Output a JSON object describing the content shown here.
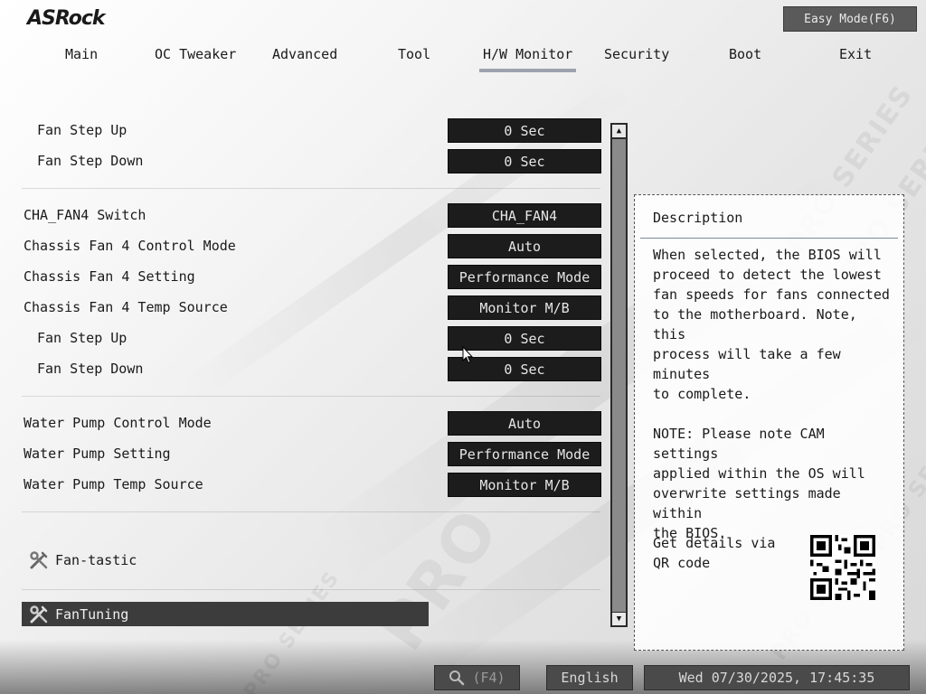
{
  "brand": {
    "logo": "ASRock"
  },
  "header": {
    "easy_mode": "Easy Mode(F6)"
  },
  "nav": {
    "tabs": [
      "Main",
      "OC Tweaker",
      "Advanced",
      "Tool",
      "H/W Monitor",
      "Security",
      "Boot",
      "Exit"
    ],
    "active": "H/W Monitor"
  },
  "settings": [
    {
      "label": "Fan Step Up",
      "value": "0 Sec"
    },
    {
      "label": "Fan Step Down",
      "value": "0 Sec"
    },
    {
      "label": "CHA_FAN4 Switch",
      "value": "CHA_FAN4"
    },
    {
      "label": "Chassis Fan 4 Control Mode",
      "value": "Auto"
    },
    {
      "label": "Chassis Fan 4 Setting",
      "value": "Performance Mode"
    },
    {
      "label": "Chassis Fan 4 Temp Source",
      "value": "Monitor M/B"
    },
    {
      "label": "Fan Step Up",
      "value": "0 Sec"
    },
    {
      "label": "Fan Step Down",
      "value": "0 Sec"
    },
    {
      "label": "Water Pump Control Mode",
      "value": "Auto"
    },
    {
      "label": "Water Pump Setting",
      "value": "Performance Mode"
    },
    {
      "label": "Water Pump Temp Source",
      "value": "Monitor M/B"
    }
  ],
  "tools": {
    "fan_tastic": "Fan-tastic",
    "fan_tuning": "FanTuning"
  },
  "description": {
    "title": "Description",
    "body": "When selected, the BIOS will\nproceed to detect the lowest\nfan speeds for fans connected\nto the motherboard. Note, this\nprocess will take a few minutes\nto complete.\n\nNOTE: Please note CAM settings\napplied within the OS will\noverwrite settings made within\nthe BIOS.",
    "qr_text": "Get details via QR code"
  },
  "footer": {
    "search_key": "(F4)",
    "language": "English",
    "datetime": "Wed 07/30/2025, 17:45:35"
  },
  "colors": {
    "value_bg": "#1c1c1c",
    "selected_bg": "#3c3c3c",
    "active_tab_underline": "#9ca3ad"
  },
  "icons": [
    "wrench-screwdriver-icon",
    "search-icon",
    "scroll-up-arrow-icon",
    "scroll-down-arrow-icon",
    "qr-code-icon",
    "mouse-pointer-icon"
  ]
}
